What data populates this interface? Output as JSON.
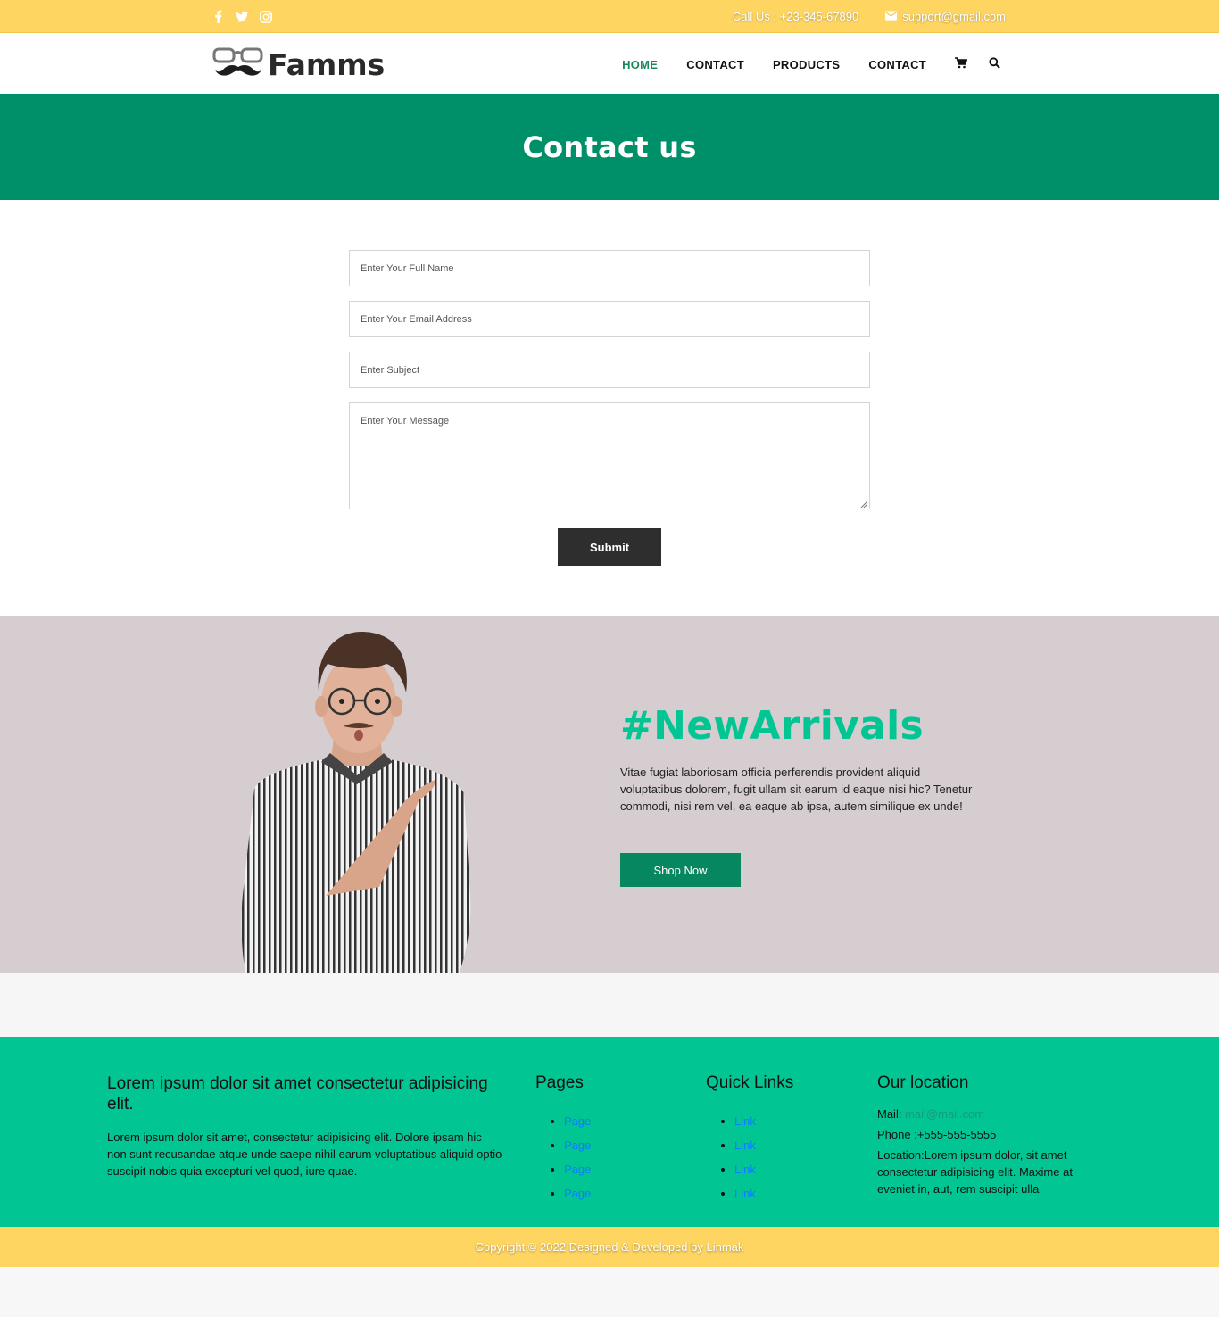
{
  "topbar": {
    "social_icons": [
      "facebook-icon",
      "twitter-icon",
      "instagram-icon"
    ],
    "call_text": "Call Us : +23-345-67890",
    "email_text": "support@gmail.com"
  },
  "navbar": {
    "logo_text": "Famms",
    "items": [
      {
        "label": "HOME",
        "active": true
      },
      {
        "label": "CONTACT",
        "active": false
      },
      {
        "label": "PRODUCTS",
        "active": false
      },
      {
        "label": "CONTACT",
        "active": false
      }
    ],
    "icons": [
      "cart-icon",
      "search-icon"
    ]
  },
  "hero": {
    "title": "Contact us"
  },
  "form": {
    "name_placeholder": "Enter Your Full Name",
    "email_placeholder": "Enter Your Email Address",
    "subject_placeholder": "Enter Subject",
    "message_placeholder": "Enter Your Message",
    "submit_label": "Submit"
  },
  "arrivals": {
    "title": "#NewArrivals",
    "text": "Vitae fugiat laboriosam officia perferendis provident aliquid voluptatibus dolorem, fugit ullam sit earum id eaque nisi hic? Tenetur commodi, nisi rem vel, ea eaque ab ipsa, autem similique ex unde!",
    "button_label": "Shop Now"
  },
  "footer": {
    "about_title": "Lorem ipsum dolor sit amet consectetur adipisicing elit.",
    "about_text": "Lorem ipsum dolor sit amet, consectetur adipisicing elit. Dolore ipsam hic non sunt recusandae atque unde saepe nihil earum voluptatibus aliquid optio suscipit nobis quia excepturi vel quod, iure quae.",
    "pages_title": "Pages",
    "pages": [
      "Page",
      "Page",
      "Page",
      "Page"
    ],
    "quick_title": "Quick Links",
    "quick_links": [
      "Link",
      "Link",
      "Link",
      "Link"
    ],
    "location_title": "Our location",
    "mail_label": "Mail:",
    "mail_value": "mail@mail.com",
    "phone": "Phone :+555-555-5555",
    "location": "Location:Lorem ipsum dolor, sit amet consectetur adipisicing elit. Maxime at eveniet in, aut, rem suscipit ulla"
  },
  "copyright": "Copyright © 2022 Designed & Developed by Linmak",
  "colors": {
    "topbar": "#ffd561",
    "hero": "#009069",
    "accent": "#02c594",
    "button_dark": "#2e2e2e",
    "shop_button": "#07875f",
    "arrivals_bg": "#d5cdd0"
  }
}
